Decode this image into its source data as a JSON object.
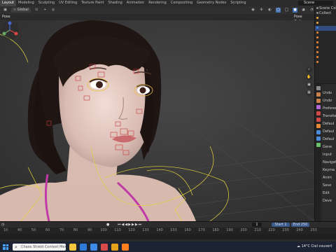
{
  "topbar": {
    "workspaces": [
      "Layout",
      "Modeling",
      "Sculpting",
      "UV Editing",
      "Texture Paint",
      "Shading",
      "Animation",
      "Rendering",
      "Compositing",
      "Geometry Nodes",
      "Scripting"
    ],
    "active_workspace": "Layout",
    "scene_label": "Scene"
  },
  "viewport_header": {
    "orientation": "Global",
    "mode": "Pose",
    "pose_options": "Pose Options"
  },
  "outliner": {
    "rows": [
      {
        "label": "Scene Coll",
        "color": "#888888"
      },
      {
        "label": "Collect",
        "color": "#888888"
      },
      {
        "label": "",
        "color": "#e0a040"
      },
      {
        "label": "",
        "color": "#e0a040"
      },
      {
        "label": "",
        "color": "#3d7fd1"
      },
      {
        "label": "",
        "color": "#e07f3a"
      },
      {
        "label": "",
        "color": "#e07f3a"
      },
      {
        "label": "",
        "color": "#e07f3a"
      },
      {
        "label": "",
        "color": "#e07f3a"
      },
      {
        "label": "",
        "color": "#e07f3a"
      },
      {
        "label": "",
        "color": "#e07f3a"
      },
      {
        "label": "",
        "color": "#e07f3a"
      }
    ]
  },
  "properties": {
    "header": "Undo",
    "rows": [
      "Undo",
      "Undo",
      "Preferen",
      "Transfor",
      "Defaul",
      "Defaul",
      "Defaul",
      "Gene",
      "Input",
      "Navigati",
      "Keyma",
      "Anim",
      "Save",
      "Edit",
      "Deve"
    ]
  },
  "timeline": {
    "playback": "Playback",
    "keying": "Keying",
    "view": "View",
    "marker": "Marker",
    "current_frame": "1",
    "start_label": "Start",
    "start": "1",
    "end_label": "End",
    "end": "250",
    "ticks": [
      "10",
      "40",
      "50",
      "60",
      "70",
      "80",
      "90",
      "100",
      "110",
      "120",
      "130",
      "140",
      "150",
      "160",
      "170",
      "180",
      "190",
      "200",
      "210",
      "220",
      "230",
      "240",
      "250"
    ]
  },
  "taskbar": {
    "search_placeholder": "Chaos Shield Context Menu",
    "weather": "14°C",
    "weather_desc": "Ciel couvert",
    "apps": [
      "#f3c640",
      "#2f7bd9",
      "#3d8be6",
      "#d84a4a",
      "#e6a21a",
      "#ff7f1f"
    ]
  },
  "colors": {
    "accent": "#4772b3",
    "armature": "#e8d640"
  }
}
